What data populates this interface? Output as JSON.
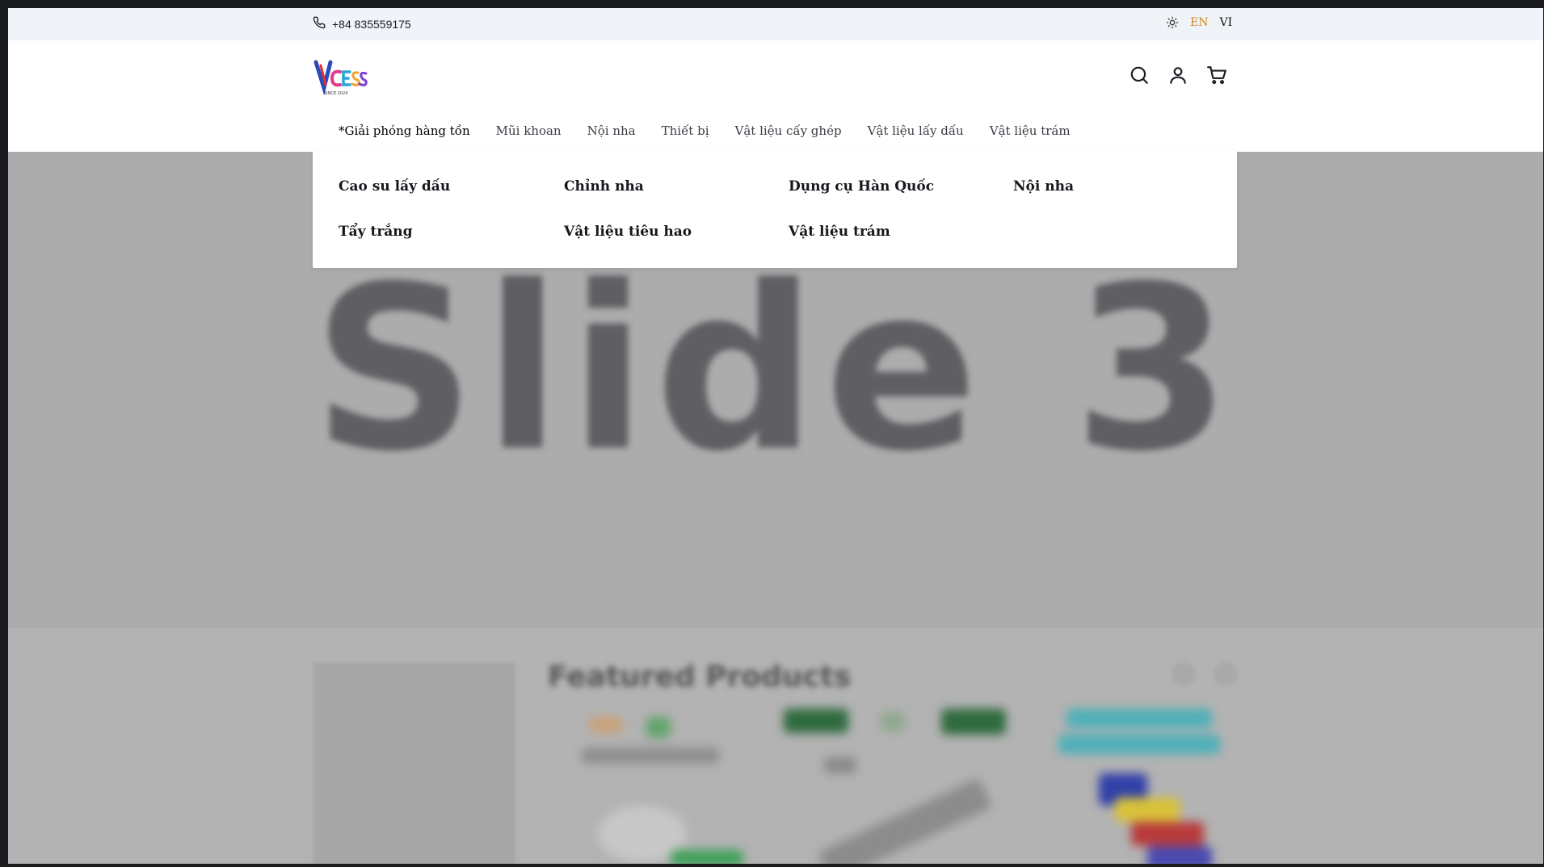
{
  "topbar": {
    "phone": "+84 835559175",
    "languages": {
      "en": "EN",
      "vi": "VI",
      "active": "EN"
    },
    "accent_color": "#d08a1c"
  },
  "header": {
    "logo_text": "VCESS",
    "logo_subtext": "SINCE 2024",
    "nav": [
      "*Giải phóng hàng tồn",
      "Mũi khoan",
      "Nội nha",
      "Thiết bị",
      "Vật liệu cấy ghép",
      "Vật liệu lấy dấu",
      "Vật liệu trám"
    ],
    "icons": [
      "search-icon",
      "user-icon",
      "cart-icon"
    ]
  },
  "dropdown": {
    "items": [
      "Cao su lấy dấu",
      "Chỉnh nha",
      "Dụng cụ Hàn Quốc",
      "Nội nha",
      "Tẩy trắng",
      "Vật liệu tiêu hao",
      "Vật liệu trám"
    ]
  },
  "hero": {
    "slide_text": "Slide 3"
  },
  "featured": {
    "title": "Featured Products"
  }
}
